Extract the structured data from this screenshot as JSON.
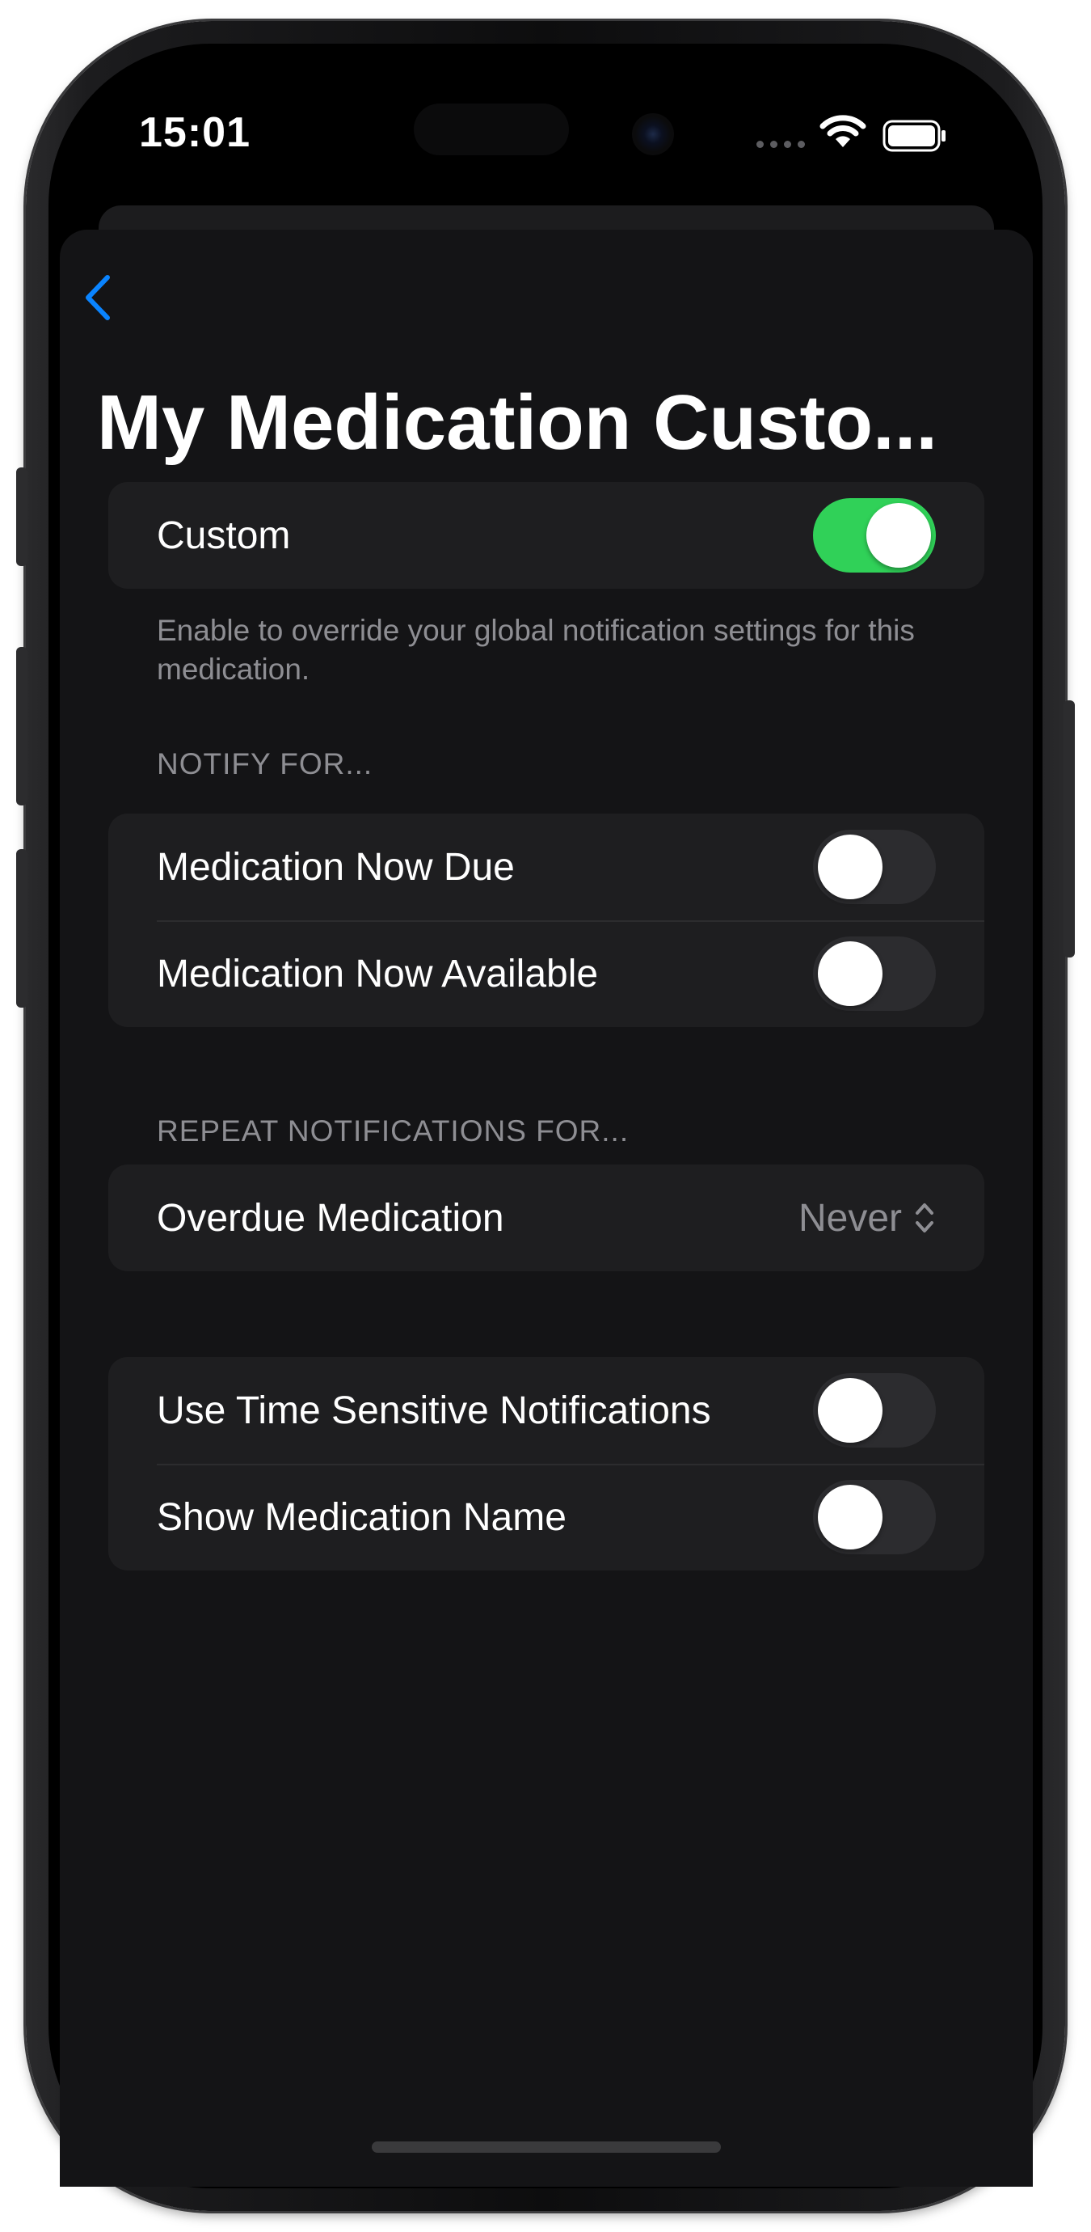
{
  "status_bar": {
    "time": "15:01"
  },
  "nav": {
    "title": "My Medication Custo...",
    "back_icon": "chevron-left-icon"
  },
  "custom_group": {
    "custom_label": "Custom",
    "custom_on": true,
    "footnote": "Enable to override your global notification settings for this medication."
  },
  "notify_group": {
    "header": "NOTIFY FOR...",
    "items": [
      {
        "label": "Medication Now Due",
        "on": false
      },
      {
        "label": "Medication Now Available",
        "on": false
      }
    ]
  },
  "repeat_group": {
    "header": "REPEAT NOTIFICATIONS FOR...",
    "overdue_label": "Overdue Medication",
    "overdue_value": "Never"
  },
  "options_group": {
    "items": [
      {
        "label": "Use Time Sensitive Notifications",
        "on": false
      },
      {
        "label": "Show Medication Name",
        "on": false
      }
    ]
  },
  "colors": {
    "accent_blue": "#0a84ff",
    "toggle_on": "#30d158",
    "background": "#141416",
    "cell": "#1e1e20"
  }
}
